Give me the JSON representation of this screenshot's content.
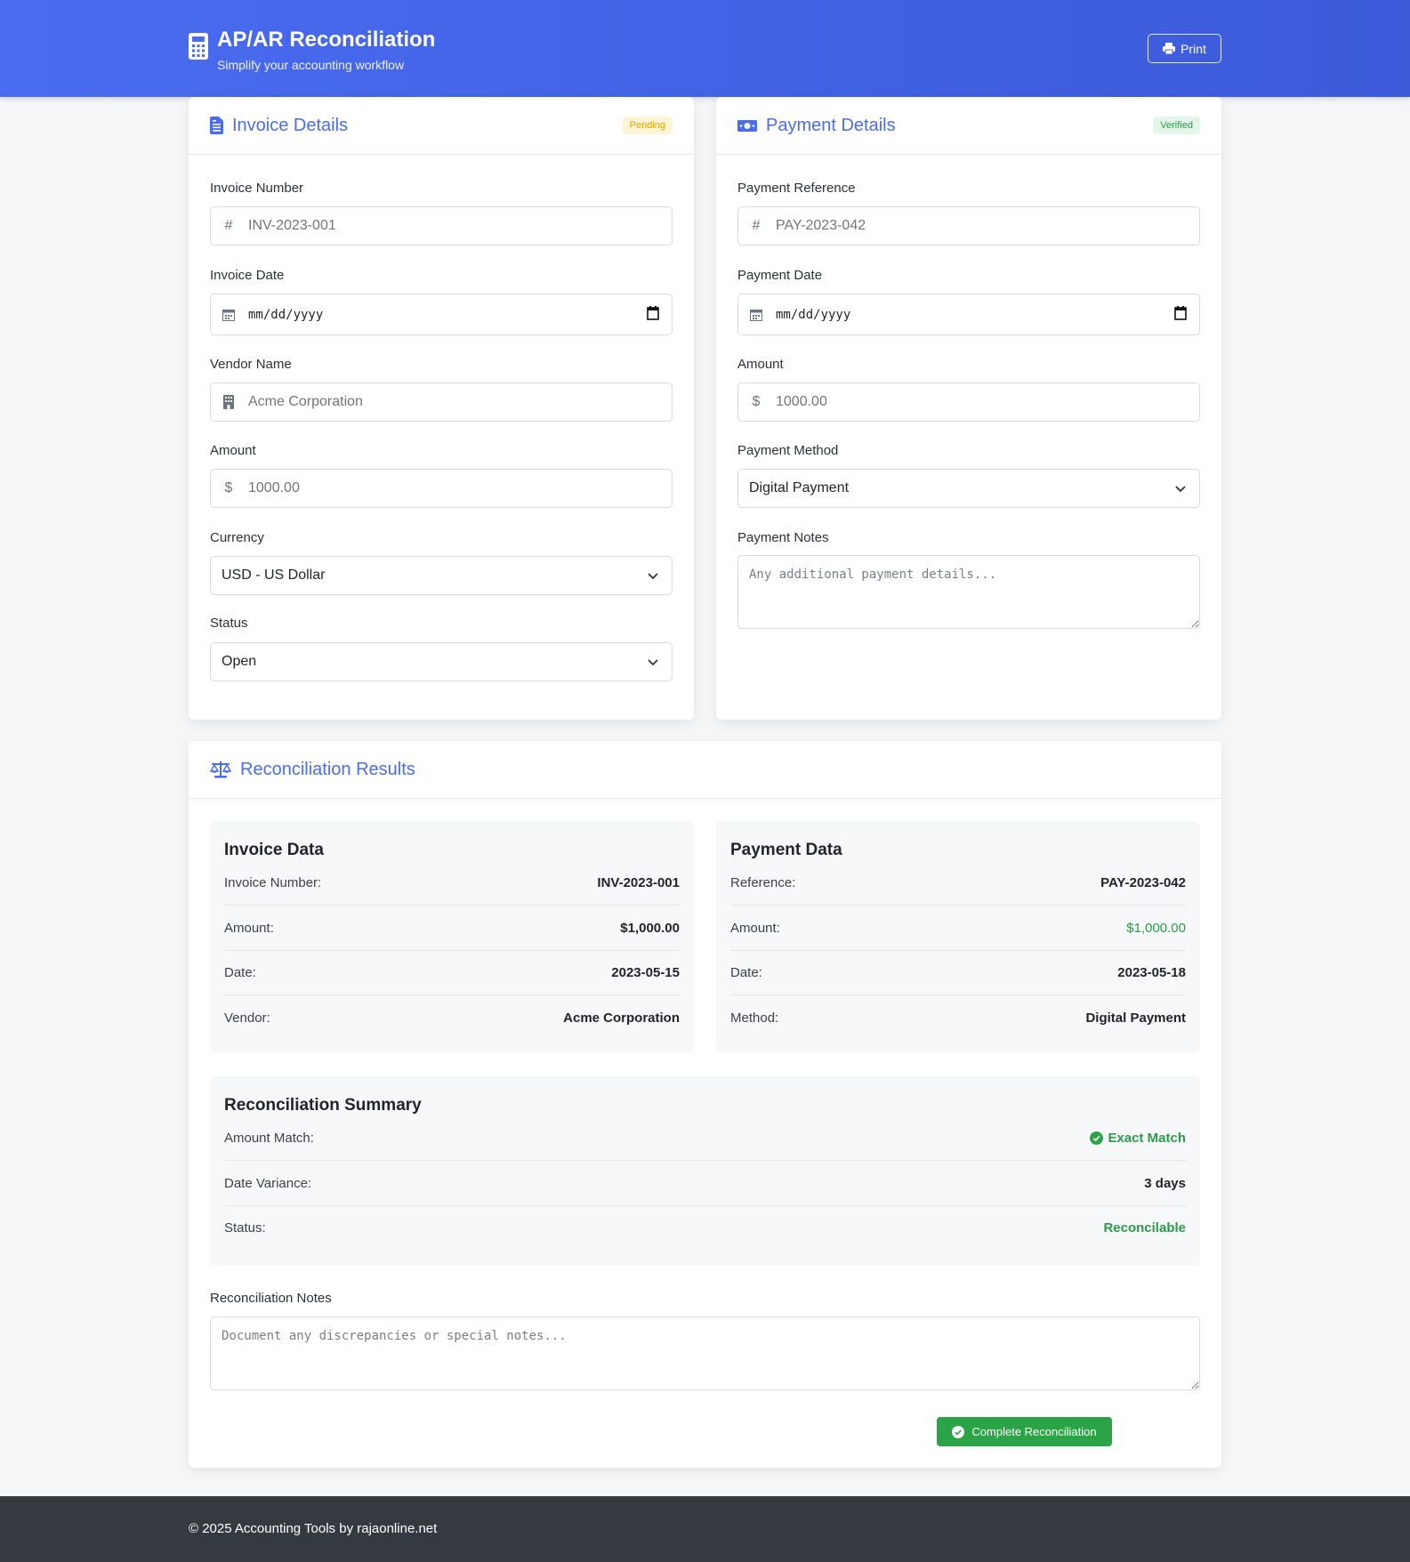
{
  "header": {
    "title": "AP/AR Reconciliation",
    "subtitle": "Simplify your accounting workflow",
    "print_label": "Print"
  },
  "invoice": {
    "title": "Invoice Details",
    "badge": "Pending",
    "number_label": "Invoice Number",
    "number_placeholder": "INV-2023-001",
    "date_label": "Invoice Date",
    "date_placeholder": "mm/dd/yyyy",
    "vendor_label": "Vendor Name",
    "vendor_placeholder": "Acme Corporation",
    "amount_label": "Amount",
    "amount_placeholder": "1000.00",
    "currency_label": "Currency",
    "currency_value": "USD - US Dollar",
    "status_label": "Status",
    "status_value": "Open"
  },
  "payment": {
    "title": "Payment Details",
    "badge": "Verified",
    "ref_label": "Payment Reference",
    "ref_placeholder": "PAY-2023-042",
    "date_label": "Payment Date",
    "date_placeholder": "mm/dd/yyyy",
    "amount_label": "Amount",
    "amount_placeholder": "1000.00",
    "method_label": "Payment Method",
    "method_value": "Digital Payment",
    "notes_label": "Payment Notes",
    "notes_placeholder": "Any additional payment details..."
  },
  "results": {
    "title": "Reconciliation Results",
    "invoice_data": {
      "title": "Invoice Data",
      "rows": [
        {
          "k": "Invoice Number:",
          "v": "INV-2023-001"
        },
        {
          "k": "Amount:",
          "v": "$1,000.00"
        },
        {
          "k": "Date:",
          "v": "2023-05-15"
        },
        {
          "k": "Vendor:",
          "v": "Acme Corporation"
        }
      ]
    },
    "payment_data": {
      "title": "Payment Data",
      "rows": [
        {
          "k": "Reference:",
          "v": "PAY-2023-042"
        },
        {
          "k": "Amount:",
          "v": "$1,000.00"
        },
        {
          "k": "Date:",
          "v": "2023-05-18"
        },
        {
          "k": "Method:",
          "v": "Digital Payment"
        }
      ]
    },
    "summary": {
      "title": "Reconciliation Summary",
      "rows": [
        {
          "k": "Amount Match:",
          "v": "Exact Match"
        },
        {
          "k": "Date Variance:",
          "v": "3 days"
        },
        {
          "k": "Status:",
          "v": "Reconcilable"
        }
      ]
    },
    "notes_label": "Reconciliation Notes",
    "notes_placeholder": "Document any discrepancies or special notes...",
    "complete_label": "Complete Reconciliation"
  },
  "footer": {
    "text": "© 2025 Accounting Tools by rajaonline.net"
  },
  "colors": {
    "primary": "#4a6cf0",
    "success": "#2aa446",
    "warning": "#e0a400",
    "footer": "#343a40"
  }
}
